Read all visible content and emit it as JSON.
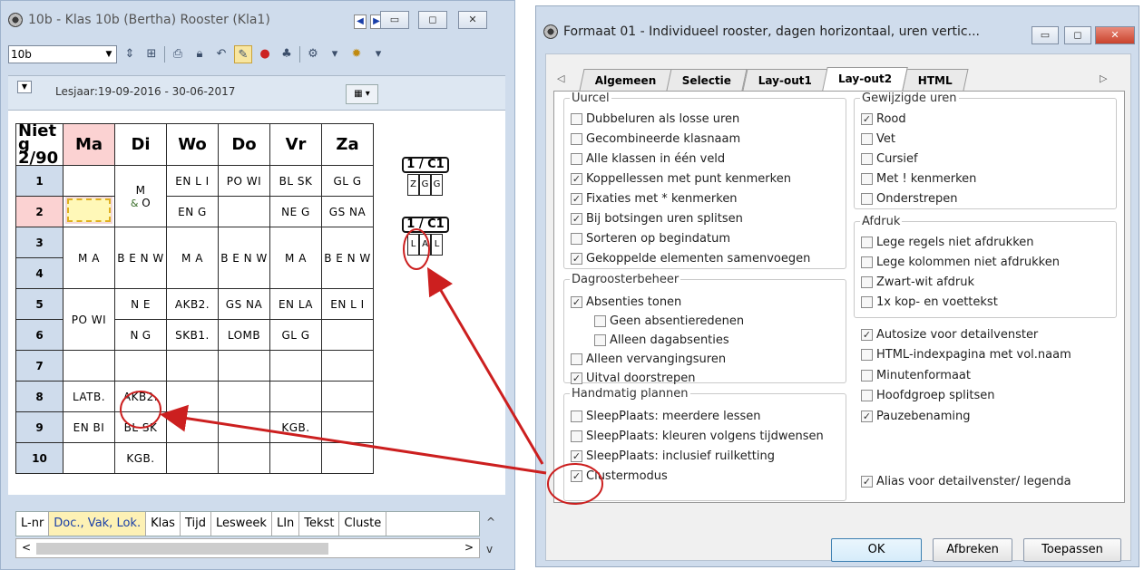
{
  "left_window": {
    "title": "10b - Klas 10b (Bertha)  Rooster  (Kla1)",
    "klas_value": "10b",
    "lesjaar": "Lesjaar:19-09-2016 - 30-06-2017",
    "corner_label_1": "Niet g",
    "corner_label_2": "2/90",
    "days": [
      "Ma",
      "Di",
      "Wo",
      "Do",
      "Vr",
      "Za"
    ],
    "hours": [
      "1",
      "2",
      "3",
      "4",
      "5",
      "6",
      "7",
      "8",
      "9",
      "10"
    ],
    "cells": {
      "r1_di": "M",
      "r1_wo": "EN L I",
      "r1_do": "PO WI",
      "r1_vr": "BL SK",
      "r1_za": "GL G",
      "r2_di": "O",
      "r2_wo": "EN G",
      "r2_vr": "NE G",
      "r2_za": "GS NA",
      "r34_ma": "M A",
      "r34_di": "B E N W",
      "r34_wo": "M A",
      "r34_do": "B E N W",
      "r34_vr": "M A",
      "r34_za": "B E N W",
      "r5_ma": "PO WI",
      "r5_di": "N E",
      "r5_wo": "AKB2.",
      "r5_do": "GS NA",
      "r5_vr": "EN LA",
      "r5_za": "EN L I",
      "r6_di_n": "N",
      "r6_di": "G",
      "r6_wo": "SKB1.",
      "r6_do": "LOMB",
      "r6_vr": "GL G",
      "r8_ma": "LATB.",
      "r8_di": "AKB2.",
      "r9_ma": "EN BI",
      "r9_di": "BL SK",
      "r9_vr": "KGB.",
      "r10_di": "KGB."
    },
    "cluster_label_1": "1 / C1",
    "cluster_cells_1": [
      "Z",
      "G",
      "G"
    ],
    "cluster_label_2": "1 / C1",
    "cluster_cells_2": [
      "L",
      "A",
      "L"
    ],
    "bottom_tabs": [
      "L-nr",
      "Doc., Vak, Lok.",
      "Klas",
      "Tijd",
      "Lesweek",
      "LIn",
      "Tekst",
      "Cluste"
    ]
  },
  "dialog": {
    "title": "Formaat 01 - Individueel rooster, dagen horizontaal, uren vertic...",
    "tabs": [
      "Algemeen",
      "Selectie",
      "Lay-out1",
      "Lay-out2",
      "HTML"
    ],
    "active_tab": "Lay-out2",
    "groups": {
      "uurcel": "Uurcel",
      "dagroosterbeheer": "Dagroosterbeheer",
      "handmatig": "Handmatig plannen",
      "gewijzigde": "Gewijzigde uren",
      "afdruk": "Afdruk"
    },
    "uurcel_items": [
      {
        "label": "Dubbeluren als losse uren",
        "checked": false
      },
      {
        "label": "Gecombineerde klasnaam",
        "checked": false
      },
      {
        "label": "Alle klassen in één veld",
        "checked": false
      },
      {
        "label": "Koppellessen met punt kenmerken",
        "checked": true
      },
      {
        "label": "Fixaties met * kenmerken",
        "checked": true
      },
      {
        "label": "Bij botsingen uren splitsen",
        "checked": true
      },
      {
        "label": "Sorteren op begindatum",
        "checked": false
      },
      {
        "label": "Gekoppelde elementen samenvoegen",
        "checked": true
      }
    ],
    "dagrooster_items": [
      {
        "label": "Absenties tonen",
        "checked": true
      },
      {
        "label": "Geen absentieredenen",
        "checked": false
      },
      {
        "label": "Alleen dagabsenties",
        "checked": false
      },
      {
        "label": "Alleen vervangingsuren",
        "checked": false
      },
      {
        "label": "Uitval doorstrepen",
        "checked": true
      }
    ],
    "handmatig_items": [
      {
        "label": "SleepPlaats: meerdere lessen",
        "checked": false
      },
      {
        "label": "SleepPlaats: kleuren volgens tijdwensen",
        "checked": false
      },
      {
        "label": "SleepPlaats: inclusief ruilketting",
        "checked": true
      },
      {
        "label": "Clustermodus",
        "checked": true
      }
    ],
    "gewijzigde_items": [
      {
        "label": "Rood",
        "checked": true
      },
      {
        "label": "Vet",
        "checked": false
      },
      {
        "label": "Cursief",
        "checked": false
      },
      {
        "label": "Met ! kenmerken",
        "checked": false
      },
      {
        "label": "Onderstrepen",
        "checked": false
      }
    ],
    "afdruk_items": [
      {
        "label": "Lege regels niet afdrukken",
        "checked": false
      },
      {
        "label": "Lege kolommen niet afdrukken",
        "checked": false
      },
      {
        "label": "Zwart-wit afdruk",
        "checked": false
      },
      {
        "label": "1x kop- en voettekst",
        "checked": false
      }
    ],
    "other_items": [
      {
        "label": "Autosize voor detailvenster",
        "checked": true
      },
      {
        "label": "HTML-indexpagina met vol.naam",
        "checked": false
      },
      {
        "label": "Minutenformaat",
        "checked": false
      },
      {
        "label": "Hoofdgroep splitsen",
        "checked": false
      },
      {
        "label": "Pauzebenaming",
        "checked": true
      }
    ],
    "alias_item": {
      "label": "Alias voor detailvenster/ legenda",
      "checked": true
    },
    "buttons": {
      "ok": "OK",
      "cancel": "Afbreken",
      "apply": "Toepassen"
    }
  },
  "colors": {
    "annotation": "#cc1f1f",
    "highlight_day": "#fbd2d2",
    "active_tab_bottom": "#fdf1b5"
  }
}
